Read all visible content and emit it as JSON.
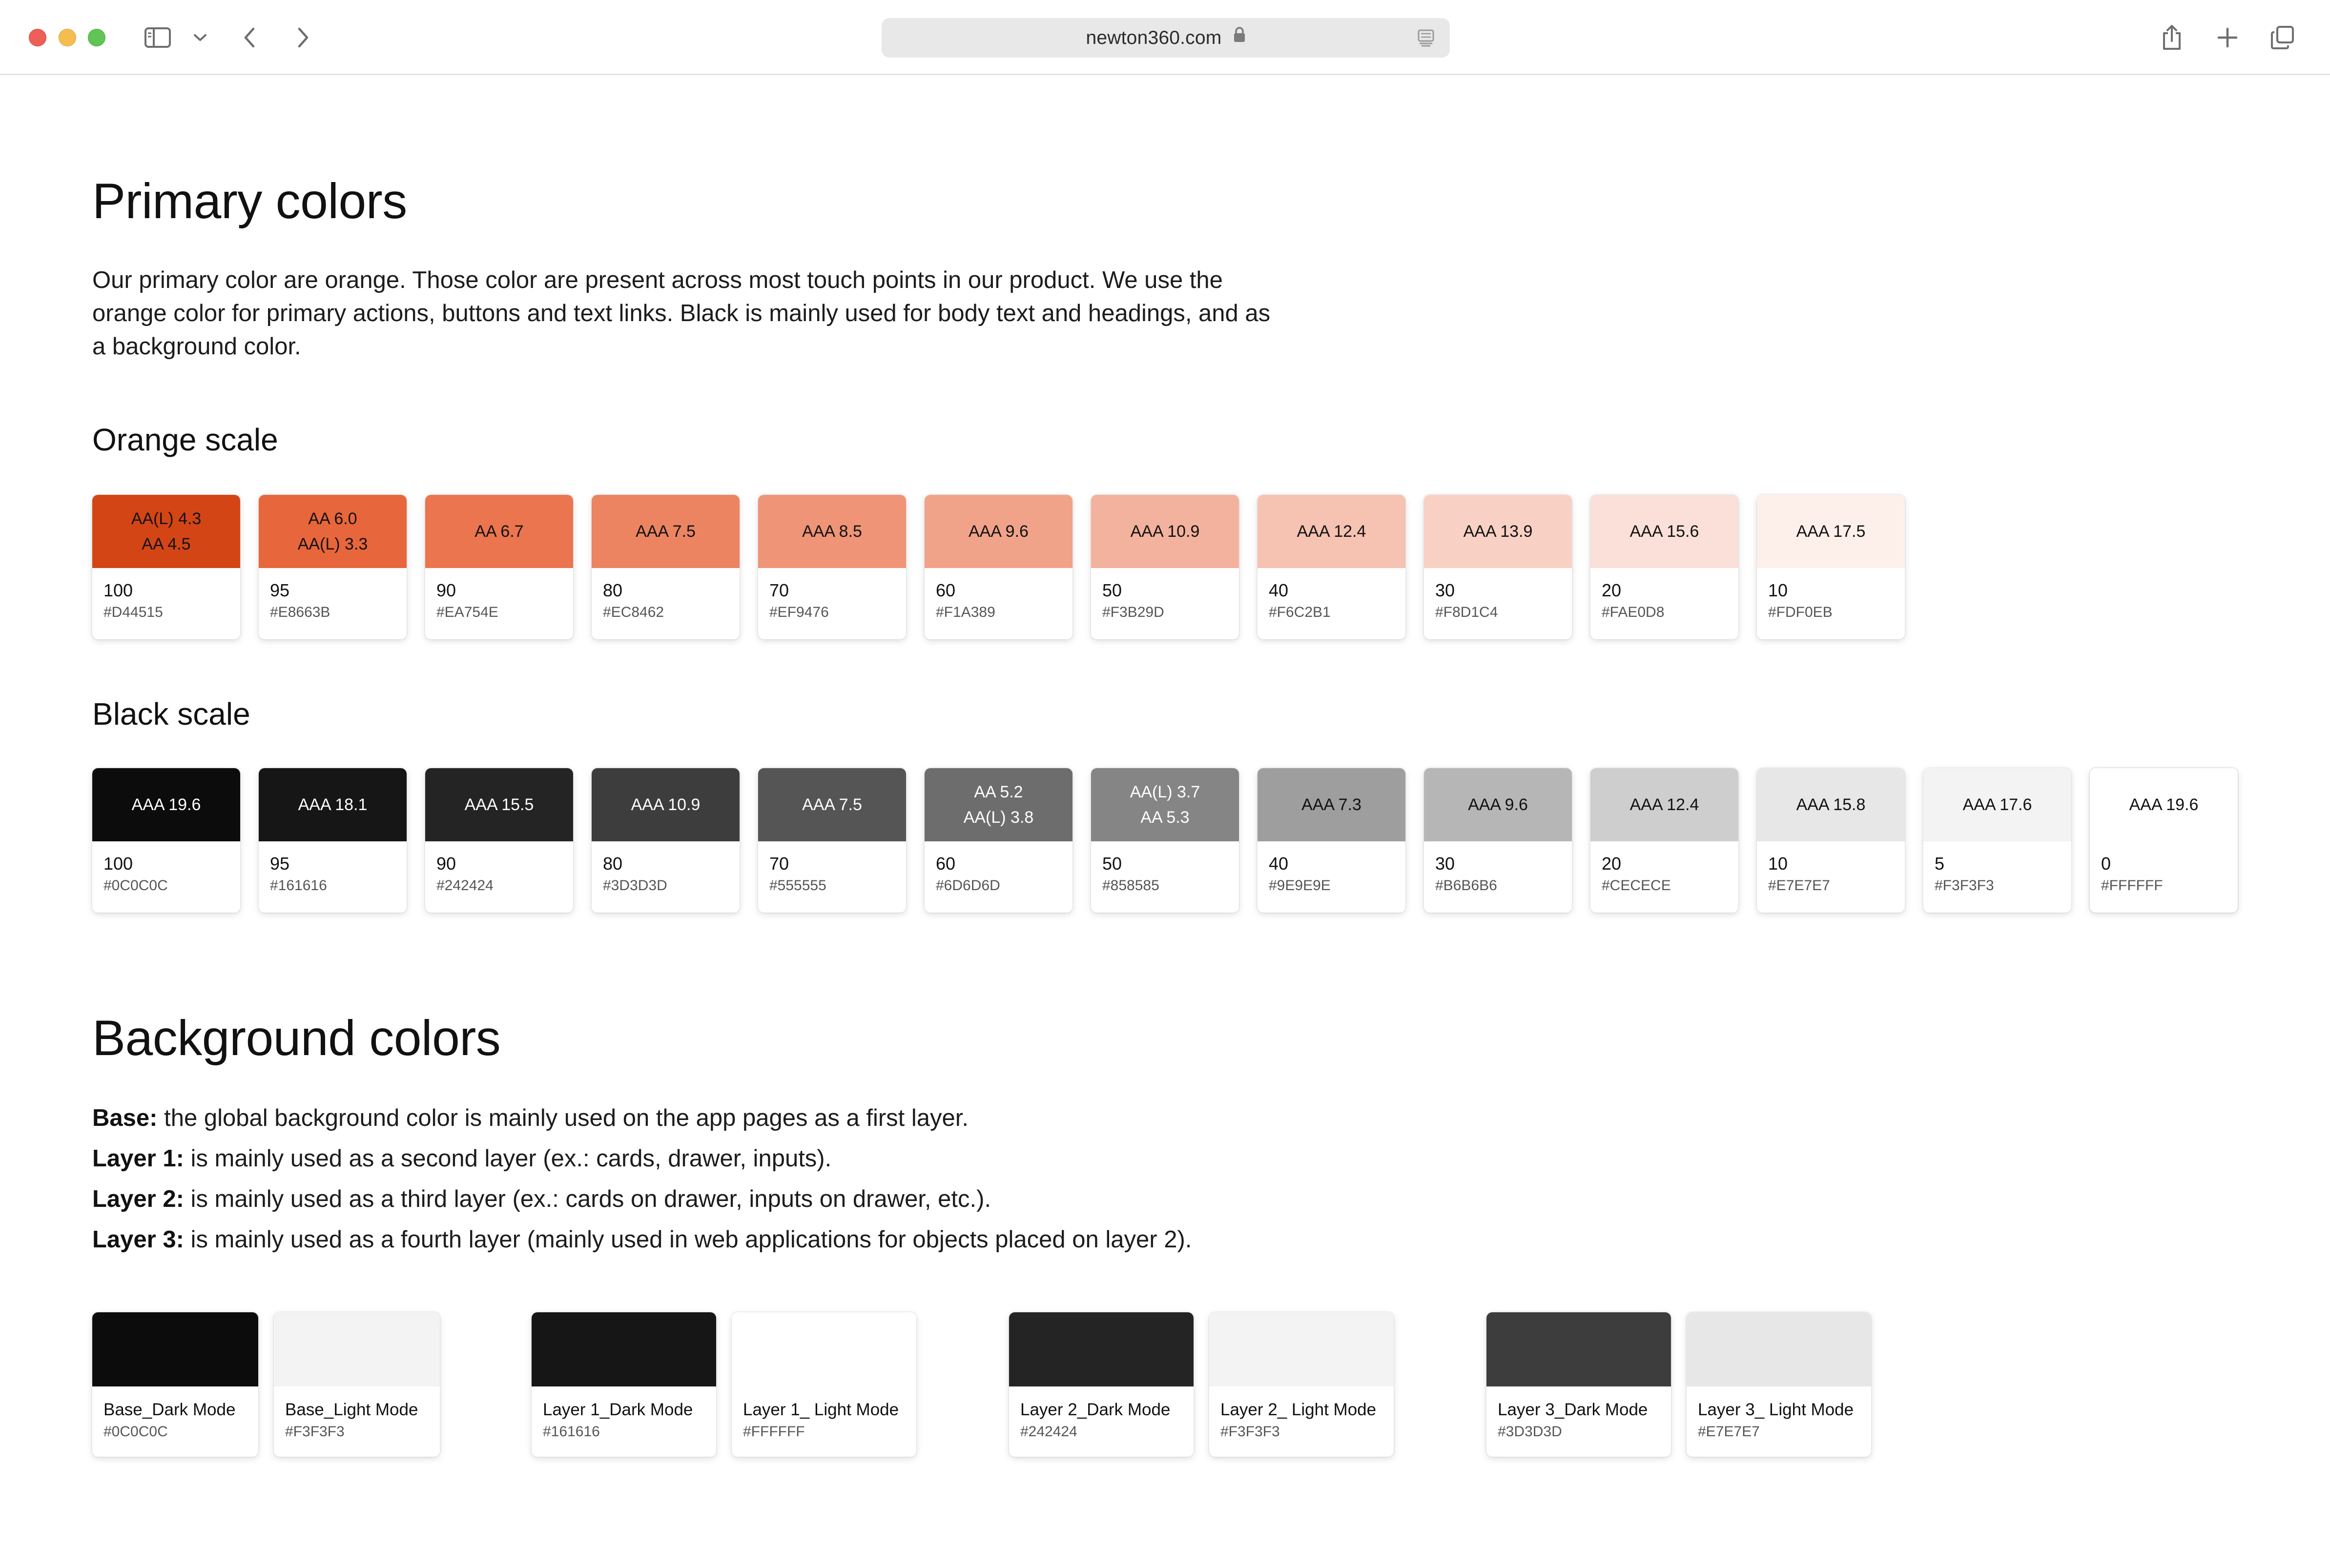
{
  "browser": {
    "url": "newton360.com"
  },
  "primary": {
    "title": "Primary colors",
    "description": "Our primary color are orange. Those color are present across most touch points in our product. We use the orange color for primary actions, buttons and text links. Black is mainly used for body text and headings, and as a background color."
  },
  "orange": {
    "title": "Orange scale",
    "swatches": [
      {
        "ratio": [
          "AA(L) 4.3",
          "AA 4.5"
        ],
        "step": "100",
        "hex": "#D44515",
        "color": "#D44515",
        "text_color": "#111111"
      },
      {
        "ratio": [
          "AA 6.0",
          "AA(L) 3.3"
        ],
        "step": "95",
        "hex": "#E8663B",
        "color": "#E8663B",
        "text_color": "#111111"
      },
      {
        "ratio": [
          "AA 6.7"
        ],
        "step": "90",
        "hex": "#EA754E",
        "color": "#EA754E",
        "text_color": "#111111"
      },
      {
        "ratio": [
          "AAA 7.5"
        ],
        "step": "80",
        "hex": "#EC8462",
        "color": "#EC8462",
        "text_color": "#111111"
      },
      {
        "ratio": [
          "AAA 8.5"
        ],
        "step": "70",
        "hex": "#EF9476",
        "color": "#EF9476",
        "text_color": "#111111"
      },
      {
        "ratio": [
          "AAA 9.6"
        ],
        "step": "60",
        "hex": "#F1A389",
        "color": "#F1A389",
        "text_color": "#111111"
      },
      {
        "ratio": [
          "AAA 10.9"
        ],
        "step": "50",
        "hex": "#F3B29D",
        "color": "#F3B29D",
        "text_color": "#111111"
      },
      {
        "ratio": [
          "AAA 12.4"
        ],
        "step": "40",
        "hex": "#F6C2B1",
        "color": "#F6C2B1",
        "text_color": "#111111"
      },
      {
        "ratio": [
          "AAA 13.9"
        ],
        "step": "30",
        "hex": "#F8D1C4",
        "color": "#F8D1C4",
        "text_color": "#111111"
      },
      {
        "ratio": [
          "AAA 15.6"
        ],
        "step": "20",
        "hex": "#FAE0D8",
        "color": "#FAE0D8",
        "text_color": "#111111"
      },
      {
        "ratio": [
          "AAA 17.5"
        ],
        "step": "10",
        "hex": "#FDF0EB",
        "color": "#FDF0EB",
        "text_color": "#111111"
      }
    ]
  },
  "black": {
    "title": "Black scale",
    "swatches": [
      {
        "ratio": [
          "AAA 19.6"
        ],
        "step": "100",
        "hex": "#0C0C0C",
        "color": "#0C0C0C",
        "text_color": "#FFFFFF"
      },
      {
        "ratio": [
          "AAA 18.1"
        ],
        "step": "95",
        "hex": "#161616",
        "color": "#161616",
        "text_color": "#FFFFFF"
      },
      {
        "ratio": [
          "AAA 15.5"
        ],
        "step": "90",
        "hex": "#242424",
        "color": "#242424",
        "text_color": "#FFFFFF"
      },
      {
        "ratio": [
          "AAA 10.9"
        ],
        "step": "80",
        "hex": "#3D3D3D",
        "color": "#3D3D3D",
        "text_color": "#FFFFFF"
      },
      {
        "ratio": [
          "AAA 7.5"
        ],
        "step": "70",
        "hex": "#555555",
        "color": "#555555",
        "text_color": "#FFFFFF"
      },
      {
        "ratio": [
          "AA 5.2",
          "AA(L) 3.8"
        ],
        "step": "60",
        "hex": "#6D6D6D",
        "color": "#6D6D6D",
        "text_color": "#FFFFFF"
      },
      {
        "ratio": [
          "AA(L) 3.7",
          "AA 5.3"
        ],
        "step": "50",
        "hex": "#858585",
        "color": "#858585",
        "text_color": "#FFFFFF"
      },
      {
        "ratio": [
          "AAA 7.3"
        ],
        "step": "40",
        "hex": "#9E9E9E",
        "color": "#9E9E9E",
        "text_color": "#111111"
      },
      {
        "ratio": [
          "AAA 9.6"
        ],
        "step": "30",
        "hex": "#B6B6B6",
        "color": "#B6B6B6",
        "text_color": "#111111"
      },
      {
        "ratio": [
          "AAA 12.4"
        ],
        "step": "20",
        "hex": "#CECECE",
        "color": "#CECECE",
        "text_color": "#111111"
      },
      {
        "ratio": [
          "AAA 15.8"
        ],
        "step": "10",
        "hex": "#E7E7E7",
        "color": "#E7E7E7",
        "text_color": "#111111"
      },
      {
        "ratio": [
          "AAA 17.6"
        ],
        "step": "5",
        "hex": "#F3F3F3",
        "color": "#F3F3F3",
        "text_color": "#111111"
      },
      {
        "ratio": [
          "AAA 19.6"
        ],
        "step": "0",
        "hex": "#FFFFFF",
        "color": "#FFFFFF",
        "text_color": "#111111"
      }
    ]
  },
  "background": {
    "title": "Background colors",
    "lines": [
      {
        "label": "Base:",
        "text": " the global background color is mainly used on the app pages as a first layer."
      },
      {
        "label": "Layer 1:",
        "text": " is mainly used as a second layer (ex.: cards, drawer, inputs)."
      },
      {
        "label": "Layer 2:",
        "text": " is mainly used as a third layer (ex.: cards on drawer, inputs on drawer, etc.)."
      },
      {
        "label": "Layer 3:",
        "text": " is mainly used as a fourth layer (mainly used in web applications for objects placed on layer 2)."
      }
    ],
    "cards": [
      {
        "name": "Base_Dark Mode",
        "hex": "#0C0C0C",
        "color": "#0C0C0C"
      },
      {
        "name": "Base_Light Mode",
        "hex": "#F3F3F3",
        "color": "#F3F3F3"
      },
      {
        "name": "Layer 1_Dark Mode",
        "hex": "#161616",
        "color": "#161616"
      },
      {
        "name": "Layer 1_ Light Mode",
        "hex": "#FFFFFF",
        "color": "#FFFFFF"
      },
      {
        "name": "Layer 2_Dark Mode",
        "hex": "#242424",
        "color": "#242424"
      },
      {
        "name": "Layer 2_ Light Mode",
        "hex": "#F3F3F3",
        "color": "#F3F3F3"
      },
      {
        "name": "Layer 3_Dark Mode",
        "hex": "#3D3D3D",
        "color": "#3D3D3D"
      },
      {
        "name": "Layer 3_ Light Mode",
        "hex": "#E7E7E7",
        "color": "#E7E7E7"
      }
    ]
  }
}
